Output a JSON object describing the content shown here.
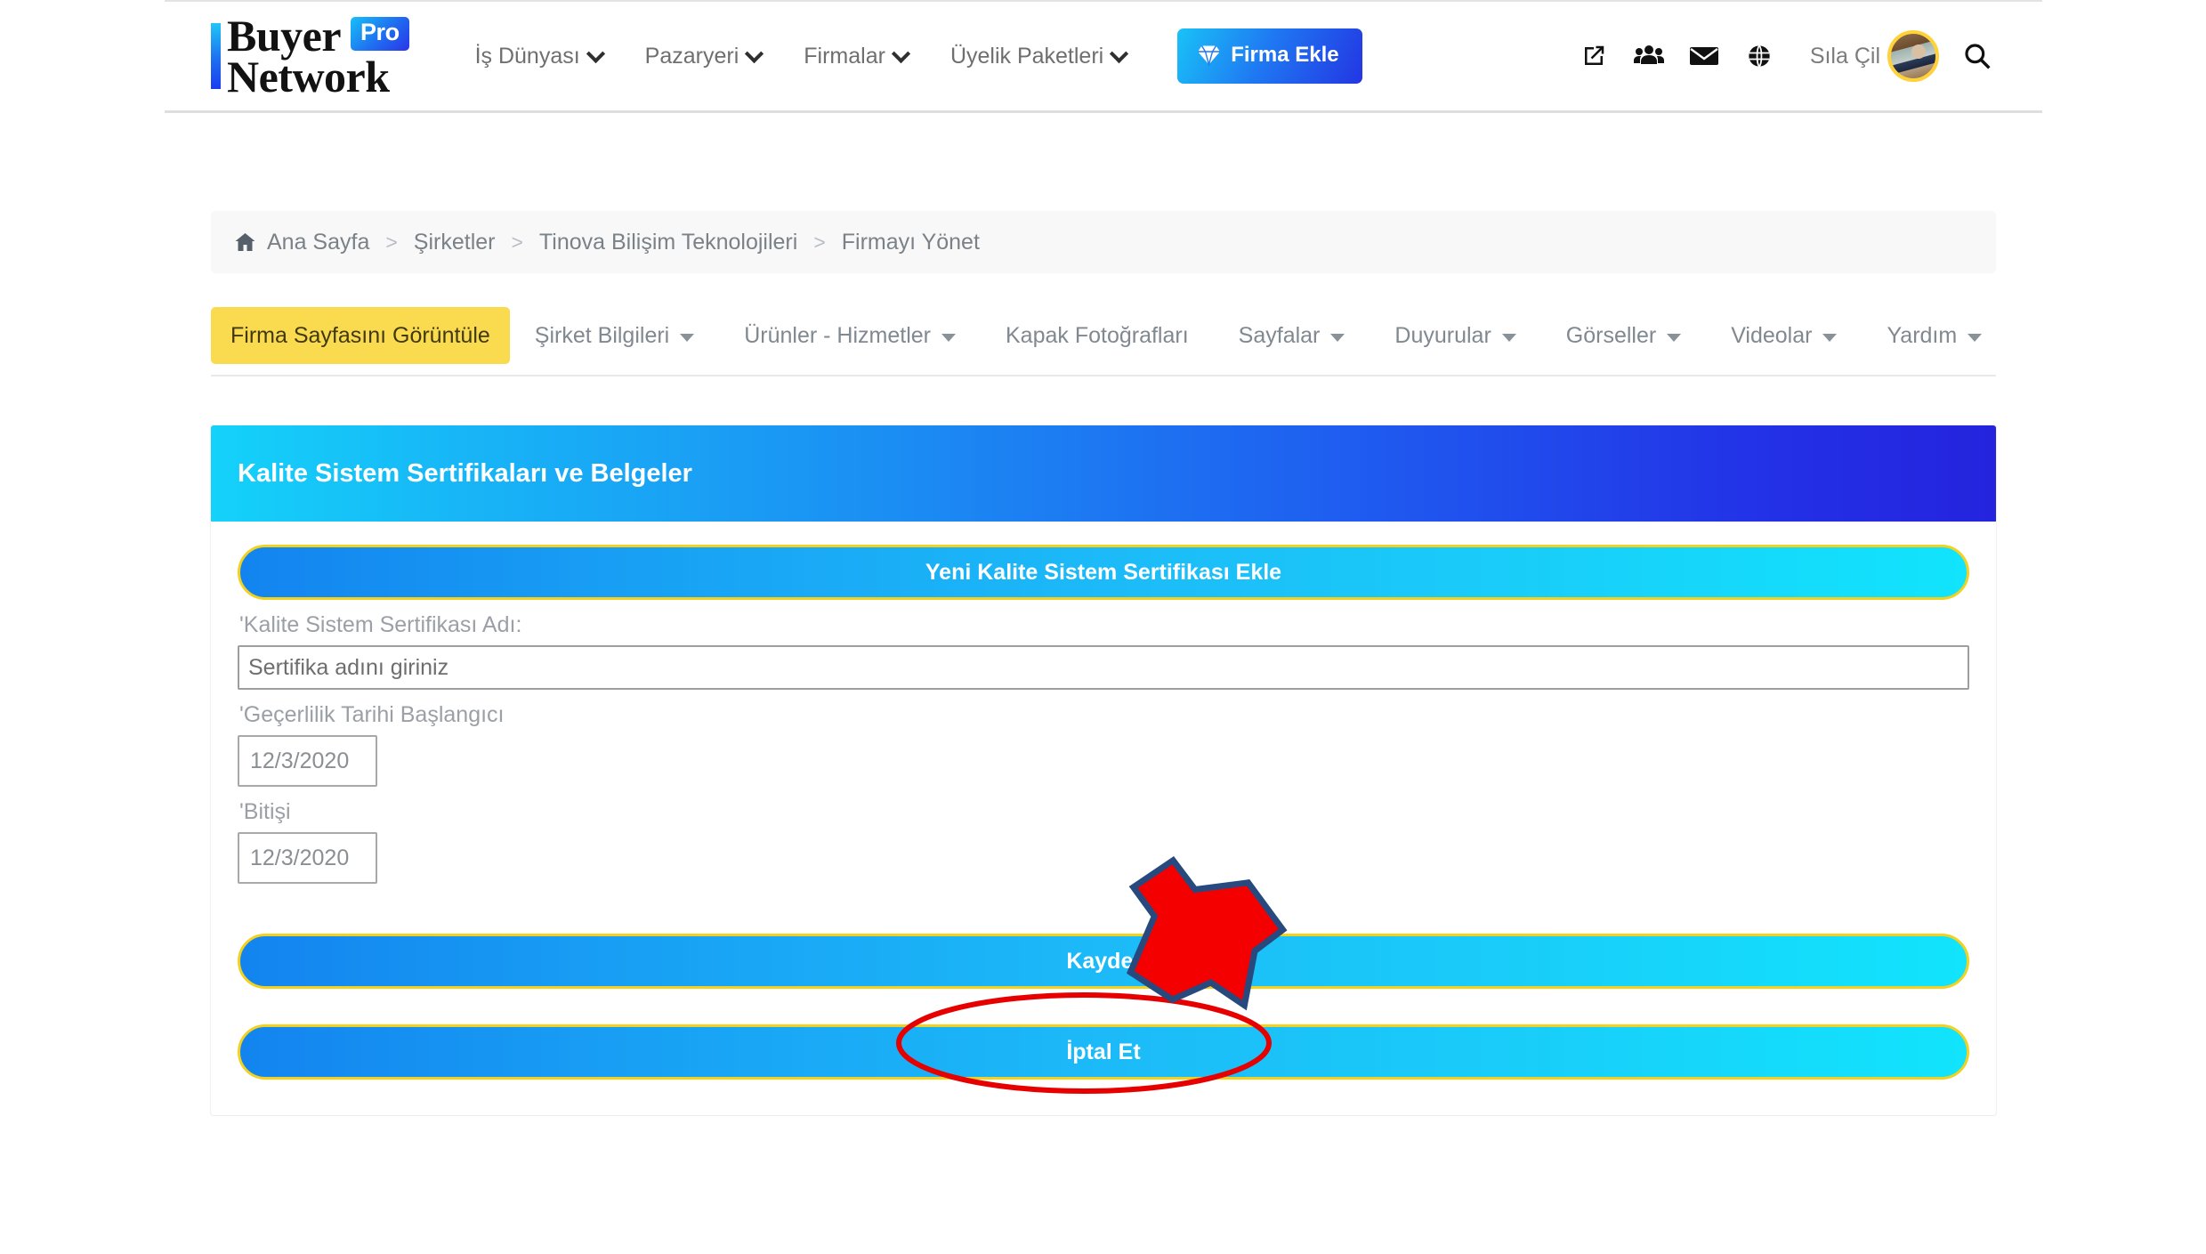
{
  "brand": {
    "name_line1": "Buyer",
    "name_line2": "Network",
    "badge": "Pro",
    "bar_color": "#1d6ff0"
  },
  "header": {
    "nav": [
      {
        "label": "İş Dünyası",
        "has_dropdown": true
      },
      {
        "label": "Pazaryeri",
        "has_dropdown": true
      },
      {
        "label": "Firmalar",
        "has_dropdown": true
      },
      {
        "label": "Üyelik Paketleri",
        "has_dropdown": true
      }
    ],
    "cta": {
      "label": "Firma Ekle",
      "icon": "gem-icon",
      "gradient_from": "#19c2f7",
      "gradient_to": "#2336e3"
    },
    "icons": [
      {
        "name": "external-link-icon"
      },
      {
        "name": "users-icon"
      },
      {
        "name": "envelope-icon"
      },
      {
        "name": "globe-icon"
      }
    ],
    "user": {
      "name": "Sıla Çil",
      "avatar_ring_color": "#ffd23a"
    },
    "search_icon": "search-icon"
  },
  "breadcrumb": {
    "home_icon": "home-icon",
    "items": [
      "Ana Sayfa",
      "Şirketler",
      "Tinova Bilişim Teknolojileri",
      "Firmayı Yönet"
    ],
    "separator": ">",
    "current_index": 3
  },
  "tabs": [
    {
      "label": "Firma Sayfasını Görüntüle",
      "active": true,
      "has_caret": false
    },
    {
      "label": "Şirket Bilgileri",
      "active": false,
      "has_caret": true
    },
    {
      "label": "Ürünler - Hizmetler",
      "active": false,
      "has_caret": true
    },
    {
      "label": "Kapak Fotoğrafları",
      "active": false,
      "has_caret": false
    },
    {
      "label": "Sayfalar",
      "active": false,
      "has_caret": true
    },
    {
      "label": "Duyurular",
      "active": false,
      "has_caret": true
    },
    {
      "label": "Görseller",
      "active": false,
      "has_caret": true
    },
    {
      "label": "Videolar",
      "active": false,
      "has_caret": true
    },
    {
      "label": "Yardım",
      "active": false,
      "has_caret": true
    }
  ],
  "panel": {
    "title": "Kalite Sistem Sertifikaları ve Belgeler",
    "header_gradient_from": "#14d2fa",
    "header_gradient_to": "#2424dd",
    "add_button_label": "Yeni Kalite Sistem Sertifikası Ekle",
    "fields": {
      "cert_name_label": "'Kalite Sistem Sertifikası Adı:",
      "cert_name_value": "",
      "cert_name_placeholder": "Sertifika adını giriniz",
      "start_date_label": "'Geçerlilik Tarihi Başlangıcı",
      "start_date_value": "12/3/2020",
      "end_date_label": "'Bitişi",
      "end_date_value": "12/3/2020"
    },
    "save_button_label": "Kaydet",
    "cancel_button_label": "İptal Et",
    "button_border_color": "#f3d11f"
  },
  "annotations": {
    "arrow": {
      "color": "#f40000",
      "outline": "#27497e",
      "points_to": "save-button"
    },
    "ellipse": {
      "color": "#e60000",
      "around": "save-button"
    }
  }
}
